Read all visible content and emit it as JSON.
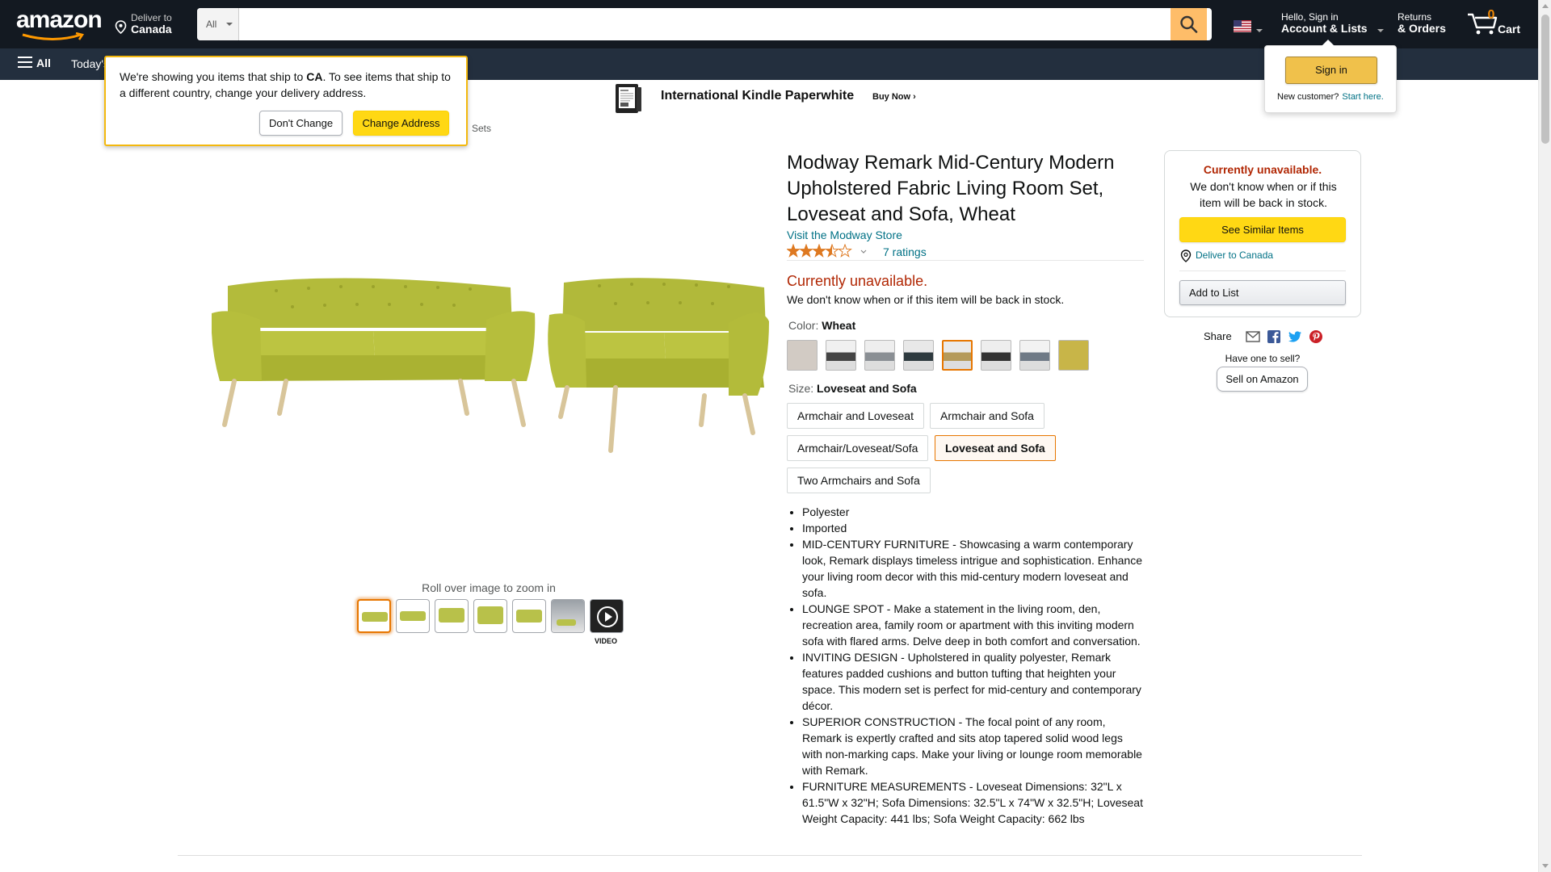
{
  "nav": {
    "logo": "amazon",
    "deliver_line1": "Deliver to",
    "deliver_line2": "Canada",
    "search_category": "All",
    "search_value": "",
    "account_line1": "Hello, Sign in",
    "account_line2": "Account & Lists",
    "returns_line1": "Returns",
    "returns_line2": "& Orders",
    "cart_count": "0",
    "cart_label": "Cart"
  },
  "subnav": {
    "all_label": "All",
    "deals_label": "Today's"
  },
  "popover": {
    "msg_pre": "We're showing you items that ship to ",
    "msg_country": "CA",
    "msg_post": ". To see items that ship to a different country, change your delivery address.",
    "dont_change": "Don't Change",
    "change_address": "Change Address"
  },
  "flyout": {
    "sign_in": "Sign in",
    "new_customer": "New customer?",
    "start_here": "Start here."
  },
  "banner": {
    "title": "International Kindle Paperwhite",
    "cta": "Buy Now ›"
  },
  "breadcrumb_tail": "Sets",
  "gallery": {
    "zoom_hint": "Roll over image to zoom in",
    "video_label": "VIDEO"
  },
  "product": {
    "title": "Modway Remark Mid-Century Modern Upholstered Fabric Living Room Set, Loveseat and Sofa, Wheat",
    "store_link": "Visit the Modway Store",
    "rating": 3.5,
    "ratings_count": "7 ratings",
    "availability": "Currently unavailable.",
    "availability_note": "We don't know when or if this item will be back in stock.",
    "color_label": "Color: ",
    "color_value": "Wheat",
    "size_label": "Size: ",
    "size_value": "Loveseat and Sofa",
    "sizes": [
      "Armchair and Loveseat",
      "Armchair and Sofa",
      "Armchair/Loveseat/Sofa",
      "Loveseat and Sofa",
      "Two Armchairs and Sofa"
    ],
    "bullets": [
      "Polyester",
      "Imported",
      "MID-CENTURY FURNITURE - Showcasing a warm contemporary look, Remark displays timeless intrigue and sophistication. Enhance your living room decor with this mid-century modern loveseat and sofa.",
      "LOUNGE SPOT - Make a statement in the living room, den, recreation area, family room or apartment with this inviting modern sofa with flared arms. Delve deep in both comfort and conversation.",
      "INVITING DESIGN - Upholstered in quality polyester, Remark features padded cushions and button tufting that heighten your space. This modern set is perfect for mid-century and contemporary décor.",
      "SUPERIOR CONSTRUCTION - The focal point of any room, Remark is expertly crafted and sits atop tapered solid wood legs with non-marking caps. Make your living or lounge room memorable with Remark.",
      "FURNITURE MEASUREMENTS - Loveseat Dimensions: 32\"L x 61.5\"W x 32\"H; Sofa Dimensions: 32.5\"L x 74\"W x 32.5\"H; Loveseat Weight Capacity: 441 lbs; Sofa Weight Capacity: 662 lbs"
    ]
  },
  "buybox": {
    "unavailable": "Currently unavailable.",
    "note": "We don't know when or if this item will be back in stock.",
    "see_similar": "See Similar Items",
    "deliver_to": "Deliver to Canada",
    "add_to_list": "Add to List"
  },
  "share": {
    "label": "Share",
    "have_one": "Have one to sell?",
    "sell_button": "Sell on Amazon"
  },
  "colors": {
    "nav_bg": "#131921",
    "subnav_bg": "#232f3e",
    "accent": "#febd69",
    "unavailable_red": "#b12704",
    "link": "#007185",
    "sofa": "#b6bd3c"
  }
}
